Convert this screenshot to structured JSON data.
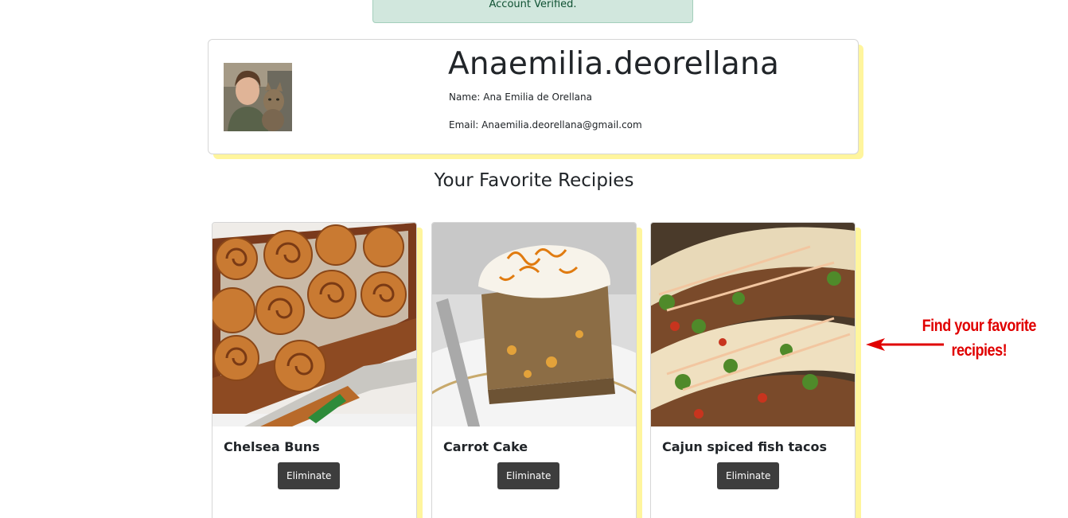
{
  "alert": {
    "text": "Account Verified."
  },
  "profile": {
    "username": "Anaemilia.deorellana",
    "name_line": "Name: Ana Emilia de Orellana",
    "email_line": "Email: Anaemilia.deorellana@gmail.com"
  },
  "section": {
    "title": "Your Favorite Recipies"
  },
  "recipes": [
    {
      "title": "Chelsea Buns",
      "button_label": "Eliminate"
    },
    {
      "title": "Carrot Cake",
      "button_label": "Eliminate"
    },
    {
      "title": "Cajun spiced fish tacos",
      "button_label": "Eliminate"
    }
  ],
  "annotation": {
    "line1": "Find your favorite",
    "line2": "recipies!",
    "color": "#e00000"
  },
  "colors": {
    "alert_bg": "#d1e7dd",
    "card_shadow": "#fff59d",
    "button_bg": "#3d3d3d"
  }
}
